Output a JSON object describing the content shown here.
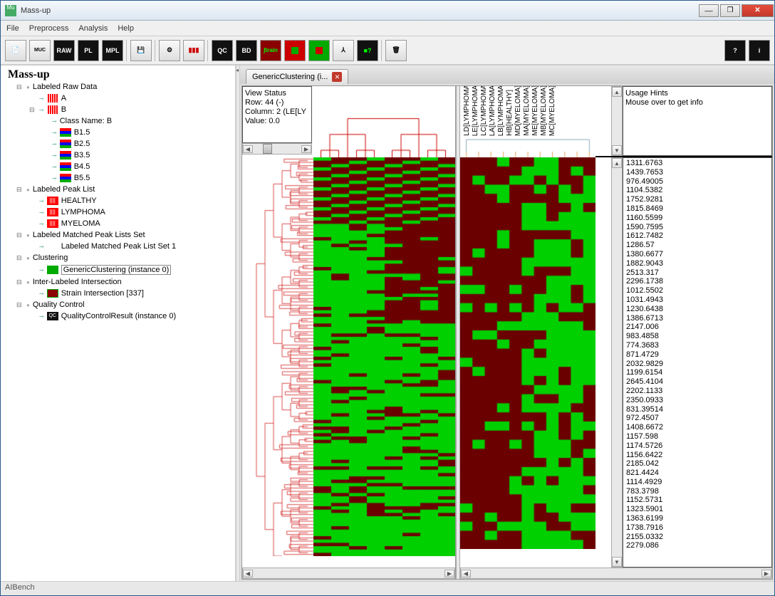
{
  "window": {
    "title": "Mass-up"
  },
  "menu": {
    "file": "File",
    "preprocess": "Preprocess",
    "analysis": "Analysis",
    "help": "Help"
  },
  "toolbar": {
    "buttons": [
      "doc",
      "muc",
      "RAW",
      "PL",
      "MPL",
      "save",
      "sep",
      "cfg",
      "chart",
      "sep",
      "QC",
      "BD",
      "strain",
      "cl1",
      "cl2",
      "dendro",
      "qc2",
      "sep",
      "trash"
    ],
    "right": [
      "?",
      "i"
    ]
  },
  "tree": {
    "root": "Mass-up",
    "items": [
      {
        "label": "Labeled Raw Data",
        "icon": "",
        "children": [
          {
            "label": "A",
            "icon": "raw"
          },
          {
            "label": "B",
            "icon": "raw",
            "children": [
              {
                "label": "Class Name: B"
              },
              {
                "label": "B1.5",
                "icon": "bars"
              },
              {
                "label": "B2.5",
                "icon": "bars"
              },
              {
                "label": "B3.5",
                "icon": "bars"
              },
              {
                "label": "B4.5",
                "icon": "bars"
              },
              {
                "label": "B5.5",
                "icon": "bars"
              }
            ]
          }
        ]
      },
      {
        "label": "Labeled Peak List",
        "children": [
          {
            "label": "HEALTHY",
            "icon": "pk"
          },
          {
            "label": "LYMPHOMA",
            "icon": "pk"
          },
          {
            "label": "MYELOMA",
            "icon": "pk"
          }
        ]
      },
      {
        "label": "Labeled Matched Peak Lists Set",
        "children": [
          {
            "label": "Labeled Matched Peak List Set 1",
            "icon": "chart"
          }
        ]
      },
      {
        "label": "Clustering",
        "children": [
          {
            "label": "GenericClustering (instance 0)",
            "icon": "cl",
            "selected": true
          }
        ]
      },
      {
        "label": "Inter-Labeled Intersection",
        "children": [
          {
            "label": "Strain Intersection [337]",
            "icon": "il"
          }
        ]
      },
      {
        "label": "Quality Control",
        "children": [
          {
            "label": "QualityControlResult (instance 0)",
            "icon": "qc"
          }
        ]
      }
    ]
  },
  "tab": {
    "label": "GenericClustering (i..."
  },
  "viewstatus": {
    "title": "View Status",
    "row": "Row:      44 (-)",
    "col": "Column: 2 (LE[LY",
    "val": "Value:  0.0"
  },
  "hints": {
    "title": "Usage Hints",
    "text": "Mouse over to get info"
  },
  "columns2": [
    "LD[LYMPHOMA]",
    "LE[LYMPHOMA]",
    "LC[LYMPHOMA]",
    "LA[LYMPHOMA]",
    "LB[LYMPHOMA]",
    "HB[HEALTHY]",
    "MD[MYELOMA]",
    "MA[MYELOMA]",
    "ME[MYELOMA]",
    "MB[MYELOMA]",
    "MC[MYELOMA]"
  ],
  "rowlabels": [
    "1311.6763",
    "1439.7653",
    "976.49005",
    "1104.5382",
    "1752.9281",
    "1815.8469",
    "1160.5599",
    "1590.7595",
    "1612.7482",
    "1286.57",
    "1380.6677",
    "1882.9043",
    "2513.317",
    "2296.1738",
    "1012.5502",
    "1031.4943",
    "1230.6438",
    "1386.6713",
    "2147.006",
    "983.4858",
    "774.3683",
    "871.4729",
    "2032.9829",
    "1199.6154",
    "2645.4104",
    "2202.1133",
    "2350.0933",
    "831.39514",
    "972.4507",
    "1408.6672",
    "1157.598",
    "1174.5726",
    "1156.6422",
    "2185.042",
    "821.4424",
    "1114.4929",
    "783.3798",
    "1152.5731",
    "1323.5901",
    "1363.6199",
    "1738.7916",
    "2155.0332",
    "2279.086"
  ],
  "status": "AIBench"
}
